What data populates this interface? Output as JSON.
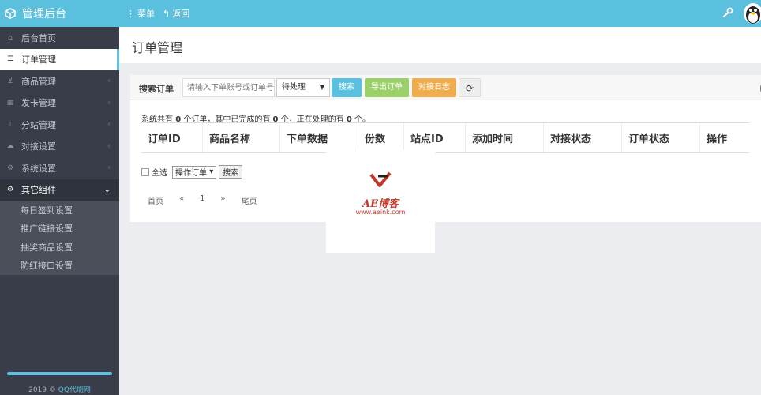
{
  "topbar": {
    "brand": "管理后台",
    "nav": [
      {
        "icon": "dots-vertical-icon",
        "label": "菜单"
      },
      {
        "icon": "reply-icon",
        "label": "返回"
      }
    ]
  },
  "sidebar": {
    "items": [
      {
        "icon": "home-icon",
        "label": "后台首页"
      },
      {
        "icon": "list-icon",
        "label": "订单管理"
      },
      {
        "icon": "cart-icon",
        "label": "商品管理"
      },
      {
        "icon": "grid-icon",
        "label": "发卡管理"
      },
      {
        "icon": "sitemap-icon",
        "label": "分站管理"
      },
      {
        "icon": "cloud-icon",
        "label": "对接设置"
      },
      {
        "icon": "gear-icon",
        "label": "系统设置"
      },
      {
        "icon": "cogs-icon",
        "label": "其它组件"
      }
    ],
    "submenu": [
      "每日签到设置",
      "推广链接设置",
      "抽奖商品设置",
      "防红接口设置"
    ],
    "footer_year": "2019 ©",
    "footer_link": "QQ代刷网"
  },
  "main": {
    "title": "订单管理",
    "search": {
      "label": "搜索订单",
      "placeholder": "请输入下单账号或订单号",
      "status_select": "待处理",
      "search_button": "搜索",
      "export_button": "导出订单",
      "log_button": "对接日志"
    },
    "summary": {
      "prefix": "系统共有",
      "total": "0",
      "mid1": "个订单，其中已完成的有",
      "done": "0",
      "mid2": "个，正在处理的有",
      "processing": "0",
      "suffix": "个。"
    },
    "columns": [
      "订单ID",
      "商品名称",
      "下单数据",
      "份数",
      "站点ID",
      "添加时间",
      "对接状态",
      "订单状态",
      "操作"
    ],
    "bulk": {
      "select_all": "全选",
      "operation": "操作订单",
      "search_button": "搜索"
    },
    "pager": [
      "首页",
      "«",
      "1",
      "»",
      "尾页"
    ]
  },
  "watermark": {
    "title": "AE博客",
    "url": "www.aeink.com"
  },
  "colors": {
    "accent": "#5bc0de",
    "sidebar_bg": "#393d49",
    "export": "#9bd06b",
    "log": "#f0ad4e"
  }
}
